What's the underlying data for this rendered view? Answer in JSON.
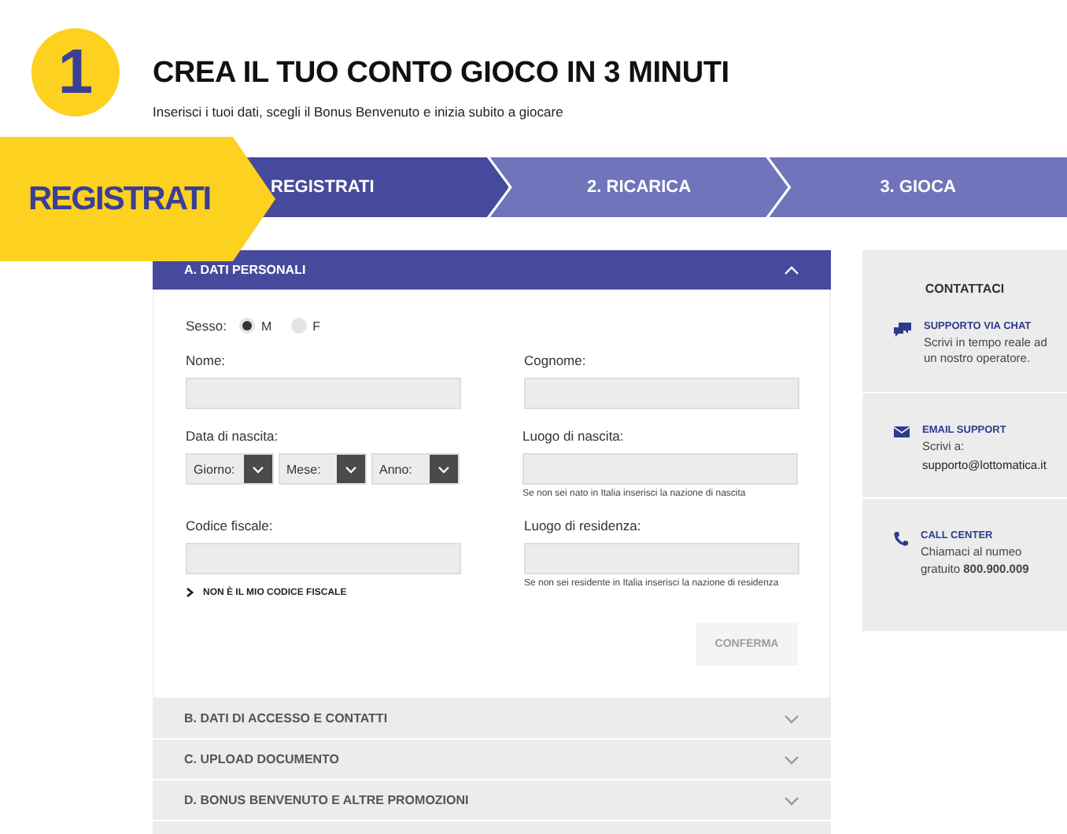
{
  "header": {
    "step_number": "1",
    "title": "CREA IL TUO CONTO GIOCO IN 3 MINUTI",
    "subtitle": "Inserisci i tuoi dati, scegli il Bonus Benvenuto e inizia subito a giocare"
  },
  "tag": {
    "label": "REGISTRATI"
  },
  "steps": [
    {
      "label": "REGISTRATI",
      "selected": true
    },
    {
      "label": "2. RICARICA",
      "selected": false
    },
    {
      "label": "3. GIOCA",
      "selected": false
    }
  ],
  "form": {
    "section": {
      "title": "A. DATI PERSONALI",
      "expanded": true
    },
    "gender": {
      "label": "Sesso:",
      "options": [
        {
          "label": "M",
          "selected": true
        },
        {
          "label": "F",
          "selected": false
        }
      ]
    },
    "first_name": {
      "label": "Nome:"
    },
    "last_name": {
      "label": "Cognome:"
    },
    "birth_date": {
      "label": "Data di nascita:",
      "selects": [
        {
          "placeholder": "Giorno:"
        },
        {
          "placeholder": "Mese:"
        },
        {
          "placeholder": "Anno:"
        }
      ]
    },
    "birth_place": {
      "label": "Luogo di nascita:",
      "hint": "Se non sei nato in Italia inserisci la nazione di nascita"
    },
    "tax_code": {
      "label": "Codice fiscale:",
      "link": "NON È IL MIO CODICE FISCALE"
    },
    "residence": {
      "label": "Luogo di residenza:",
      "hint": "Se non sei residente in Italia inserisci la nazione di residenza"
    },
    "confirm_button": {
      "label": "CONFERMA",
      "disabled": true
    }
  },
  "sections": [
    {
      "title": "B. DATI DI ACCESSO E CONTATTI",
      "expanded": false
    },
    {
      "title": "C. UPLOAD DOCUMENTO",
      "expanded": false
    },
    {
      "title": "D. BONUS BENVENUTO E ALTRE PROMOZIONI",
      "expanded": false
    },
    {
      "expanded": false
    }
  ],
  "contacts": {
    "title": "CONTATTACI",
    "items": [
      {
        "kind": "chat",
        "title": "SUPPORTO VIA CHAT",
        "text": "Scrivi in tempo reale ad un nostro operatore."
      },
      {
        "kind": "email",
        "title": "EMAIL SUPPORT",
        "text": "Scrivi a:",
        "detail": "supporto@lottomatica.it"
      },
      {
        "kind": "phone",
        "title": "CALL CENTER",
        "text": "Chiamaci al numeo gratuito **800.900.009**"
      }
    ]
  }
}
